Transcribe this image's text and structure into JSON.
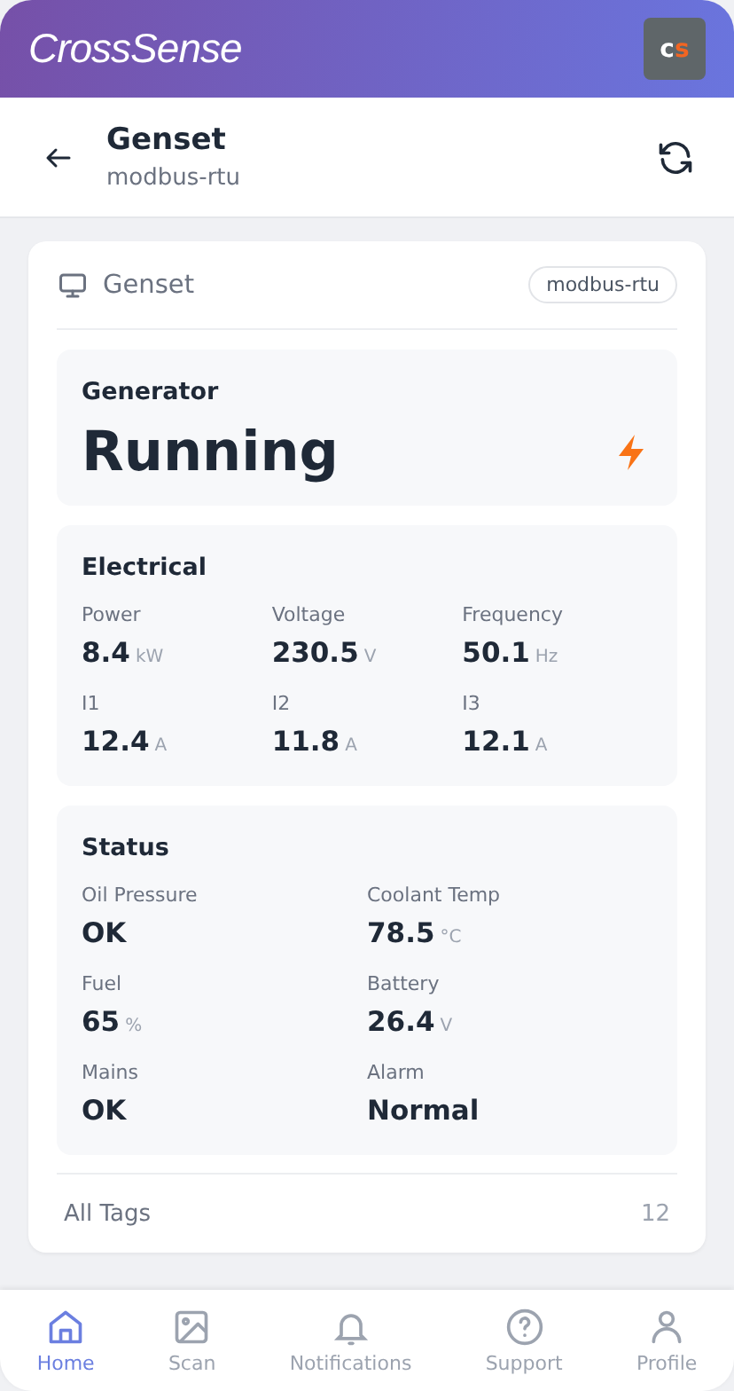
{
  "app": {
    "brand": "CrossSense",
    "avatar": {
      "first": "c",
      "second": "s"
    }
  },
  "page": {
    "title": "Genset",
    "subtitle": "modbus-rtu"
  },
  "card": {
    "title": "Genset",
    "badge": "modbus-rtu",
    "generator": {
      "title": "Generator",
      "state": "Running",
      "running": true
    },
    "sections": [
      {
        "title": "Electrical",
        "kind": "triple",
        "metrics": [
          {
            "label": "Power",
            "value": "8.4",
            "unit": "kW"
          },
          {
            "label": "Voltage",
            "value": "230.5",
            "unit": "V"
          },
          {
            "label": "Frequency",
            "value": "50.1",
            "unit": "Hz"
          },
          {
            "label": "I1",
            "value": "12.4",
            "unit": "A"
          },
          {
            "label": "I2",
            "value": "11.8",
            "unit": "A"
          },
          {
            "label": "I3",
            "value": "12.1",
            "unit": "A"
          }
        ]
      },
      {
        "title": "Status",
        "kind": "double",
        "metrics": [
          {
            "label": "Oil Pressure",
            "value": "OK"
          },
          {
            "label": "Coolant Temp",
            "value": "78.5",
            "unit": "°C"
          },
          {
            "label": "Fuel",
            "value": "65",
            "unit": "%"
          },
          {
            "label": "Battery",
            "value": "26.4",
            "unit": "V"
          },
          {
            "label": "Mains",
            "value": "OK"
          },
          {
            "label": "Alarm",
            "value": "Normal"
          }
        ]
      }
    ],
    "footer": {
      "label": "All Tags",
      "count": "12"
    }
  },
  "nav": [
    {
      "kind": "home",
      "label": "Home",
      "selected": true
    },
    {
      "kind": "scan",
      "label": "Scan",
      "selected": false
    },
    {
      "kind": "bell",
      "label": "Notifications",
      "selected": false
    },
    {
      "kind": "help",
      "label": "Support",
      "selected": false
    },
    {
      "kind": "user",
      "label": "Profile",
      "selected": false
    }
  ]
}
